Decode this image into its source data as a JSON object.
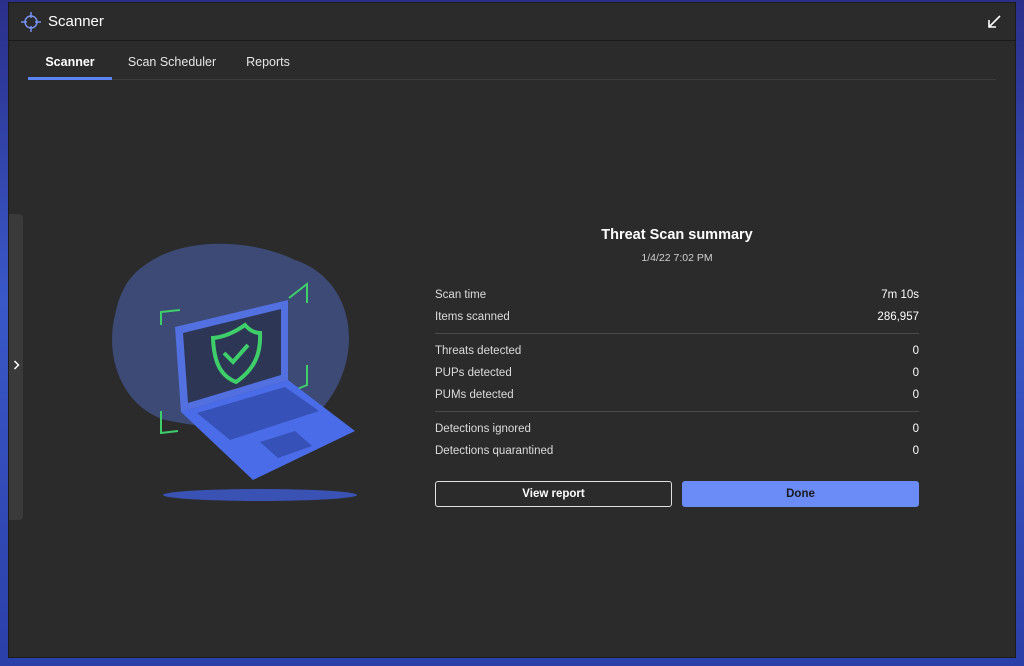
{
  "window": {
    "title": "Scanner"
  },
  "tabs": [
    {
      "label": "Scanner",
      "active": true
    },
    {
      "label": "Scan Scheduler",
      "active": false
    },
    {
      "label": "Reports",
      "active": false
    }
  ],
  "summary": {
    "title": "Threat Scan summary",
    "date": "1/4/22 7:02 PM",
    "groups": [
      [
        {
          "label": "Scan time",
          "value": "7m 10s"
        },
        {
          "label": "Items scanned",
          "value": "286,957"
        }
      ],
      [
        {
          "label": "Threats detected",
          "value": "0"
        },
        {
          "label": "PUPs detected",
          "value": "0"
        },
        {
          "label": "PUMs detected",
          "value": "0"
        }
      ],
      [
        {
          "label": "Detections ignored",
          "value": "0"
        },
        {
          "label": "Detections quarantined",
          "value": "0"
        }
      ]
    ]
  },
  "buttons": {
    "view_report": "View report",
    "done": "Done"
  },
  "icons": {
    "app": "crosshair-icon",
    "collapse": "arrow-down-left-icon",
    "side": "chevron-right-icon",
    "illustration": "laptop-shield-check-icon"
  },
  "colors": {
    "accent": "#5b84f7",
    "primary_button": "#6b8cf7",
    "check_green": "#3ecf6a"
  }
}
